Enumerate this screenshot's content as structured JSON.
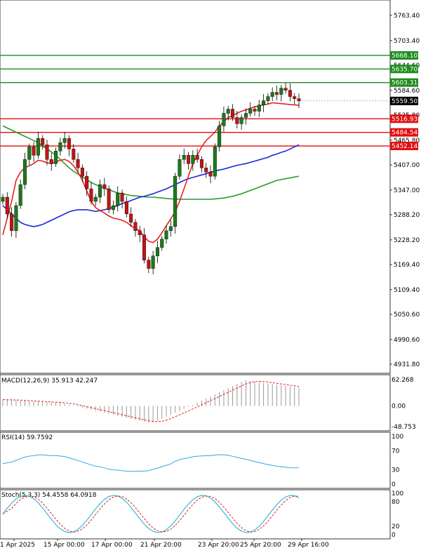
{
  "chart_data": {
    "type": "candlestick",
    "price_axis_ticks": [
      "5763.40",
      "5703.40",
      "5644.60",
      "5584.60",
      "5525.80",
      "5465.80",
      "5407.00",
      "5347.00",
      "5288.20",
      "5228.20",
      "5169.40",
      "5109.40",
      "5050.60",
      "4990.60",
      "4931.80"
    ],
    "price_ylim": [
      4910,
      5790
    ],
    "time_labels": [
      "1 Apr 2025",
      "15 Apr 00:00",
      "17 Apr 00:00",
      "21 Apr 20:00",
      "23 Apr 20:00",
      "25 Apr 20:00",
      "29 Apr 16:00"
    ],
    "levels": [
      {
        "label": "5668.10",
        "value": 5668.1,
        "color": "#1e8c1e"
      },
      {
        "label": "5635.70",
        "value": 5635.7,
        "color": "#1e8c1e"
      },
      {
        "label": "5603.31",
        "value": 5603.31,
        "color": "#1e8c1e"
      },
      {
        "label": "5516.93",
        "value": 5516.93,
        "color": "#e01010"
      },
      {
        "label": "5484.54",
        "value": 5484.54,
        "color": "#e01010"
      },
      {
        "label": "5452.14",
        "value": 5452.14,
        "color": "#e01010"
      }
    ],
    "current_price": {
      "label": "5559.50",
      "value": 5559.5
    },
    "candles_close": [
      5330,
      5290,
      5250,
      5310,
      5360,
      5420,
      5450,
      5430,
      5470,
      5455,
      5420,
      5410,
      5440,
      5460,
      5470,
      5445,
      5420,
      5400,
      5380,
      5350,
      5320,
      5330,
      5360,
      5350,
      5300,
      5310,
      5340,
      5320,
      5290,
      5270,
      5250,
      5240,
      5180,
      5160,
      5190,
      5210,
      5230,
      5250,
      5260,
      5380,
      5420,
      5430,
      5410,
      5430,
      5420,
      5400,
      5390,
      5380,
      5450,
      5500,
      5530,
      5540,
      5520,
      5505,
      5520,
      5530,
      5540,
      5535,
      5550,
      5560,
      5570,
      5580,
      5575,
      5590,
      5585,
      5570,
      5565,
      5559.5
    ],
    "ma_fast_red": [
      5240,
      5280,
      5320,
      5370,
      5390,
      5400,
      5405,
      5410,
      5418,
      5416,
      5412,
      5410,
      5414,
      5418,
      5420,
      5415,
      5405,
      5390,
      5370,
      5345,
      5320,
      5305,
      5298,
      5292,
      5285,
      5280,
      5278,
      5275,
      5270,
      5262,
      5255,
      5250,
      5235,
      5225,
      5222,
      5230,
      5245,
      5262,
      5278,
      5295,
      5320,
      5350,
      5380,
      5410,
      5430,
      5450,
      5465,
      5475,
      5485,
      5500,
      5510,
      5520,
      5525,
      5530,
      5535,
      5538,
      5542,
      5545,
      5548,
      5550,
      5552,
      5555,
      5554,
      5553,
      5552,
      5551,
      5550,
      5549
    ],
    "ma_mid_blue": [
      5310,
      5300,
      5290,
      5280,
      5270,
      5265,
      5262,
      5260,
      5262,
      5265,
      5270,
      5275,
      5280,
      5285,
      5290,
      5295,
      5298,
      5300,
      5300,
      5300,
      5298,
      5296,
      5298,
      5300,
      5303,
      5306,
      5310,
      5315,
      5318,
      5322,
      5326,
      5330,
      5332,
      5335,
      5338,
      5342,
      5346,
      5350,
      5355,
      5360,
      5365,
      5370,
      5374,
      5377,
      5380,
      5383,
      5386,
      5390,
      5392,
      5395,
      5397,
      5400,
      5403,
      5406,
      5408,
      5410,
      5413,
      5416,
      5419,
      5422,
      5425,
      5430,
      5433,
      5437,
      5440,
      5445,
      5450,
      5455
    ],
    "ma_slow_green": [
      5500,
      5495,
      5490,
      5485,
      5480,
      5475,
      5470,
      5465,
      5460,
      5452,
      5445,
      5438,
      5430,
      5420,
      5410,
      5400,
      5392,
      5385,
      5378,
      5372,
      5365,
      5360,
      5356,
      5352,
      5348,
      5344,
      5340,
      5338,
      5336,
      5334,
      5333,
      5332,
      5331,
      5330,
      5330,
      5329,
      5328,
      5327,
      5326,
      5326,
      5325,
      5325,
      5325,
      5325,
      5325,
      5325,
      5325,
      5325,
      5326,
      5327,
      5328,
      5330,
      5332,
      5335,
      5338,
      5342,
      5346,
      5350,
      5354,
      5358,
      5362,
      5366,
      5370,
      5372,
      5374,
      5376,
      5378,
      5380
    ],
    "macd": {
      "label": "MACD(12,26,9) 35.913 42.247",
      "ticks": [
        "62.268",
        "0.00",
        "-48.753"
      ],
      "range": [
        -48.753,
        62.268
      ]
    },
    "rsi": {
      "label": "RSI(14) 59.7592",
      "ticks": [
        "100",
        "70",
        "30",
        "0"
      ]
    },
    "stoch": {
      "label": "Stoch(5,3,3) 54.4558 64.0918",
      "ticks": [
        "100",
        "80",
        "20",
        "0"
      ]
    }
  }
}
